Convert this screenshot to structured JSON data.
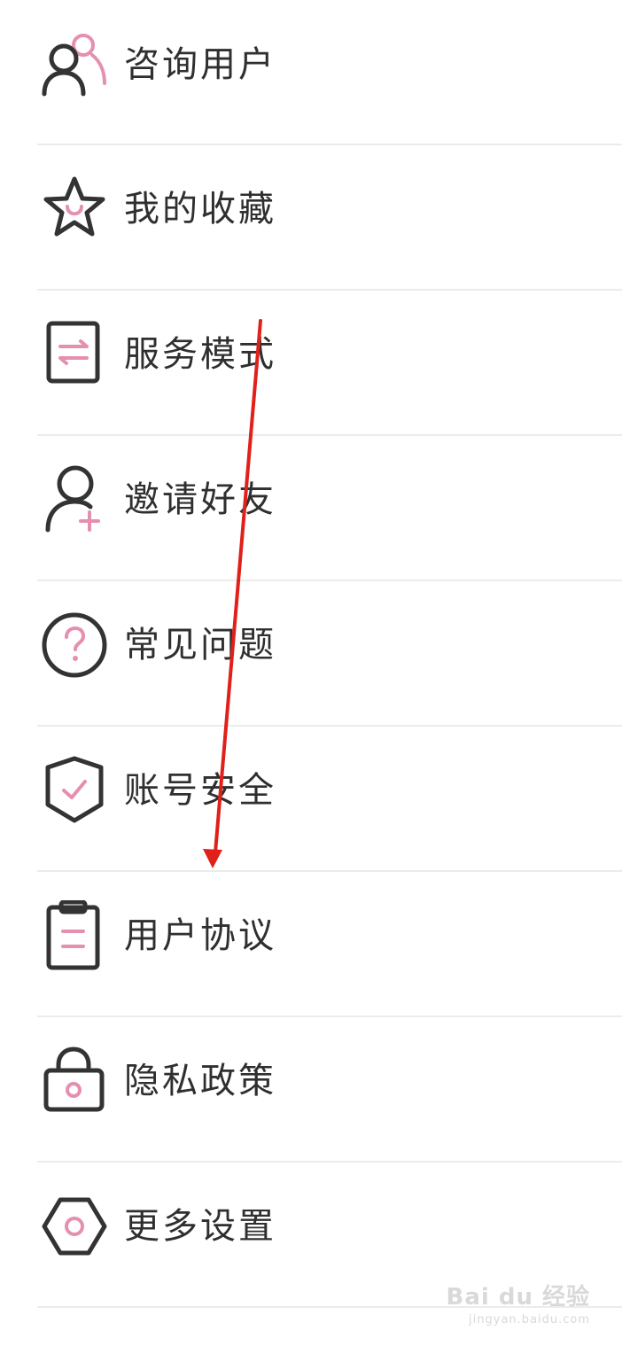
{
  "colors": {
    "text": "#2f2f2f",
    "icon_dark": "#333333",
    "icon_accent": "#e58fb1",
    "divider": "#ececec",
    "annotation_arrow": "#e0201a"
  },
  "menu": {
    "items": [
      {
        "label": "咨询用户",
        "icon": "users-icon"
      },
      {
        "label": "我的收藏",
        "icon": "star-icon"
      },
      {
        "label": "服务模式",
        "icon": "switch-mode-icon"
      },
      {
        "label": "邀请好友",
        "icon": "add-friend-icon"
      },
      {
        "label": "常见问题",
        "icon": "question-icon"
      },
      {
        "label": "账号安全",
        "icon": "shield-check-icon"
      },
      {
        "label": "用户协议",
        "icon": "clipboard-icon"
      },
      {
        "label": "隐私政策",
        "icon": "lock-icon"
      },
      {
        "label": "更多设置",
        "icon": "settings-hexagon-icon"
      }
    ]
  },
  "watermark": {
    "brand": "Bai du 经验",
    "url": "jingyan.baidu.com"
  }
}
